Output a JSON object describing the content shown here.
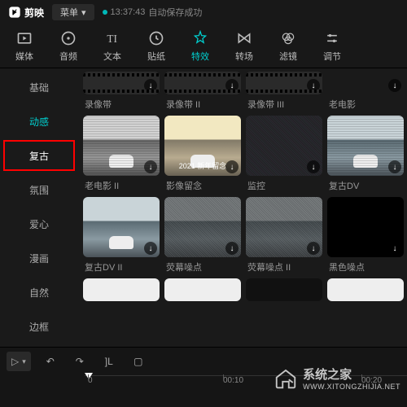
{
  "titlebar": {
    "app_name": "剪映",
    "menu_label": "菜单",
    "save_time": "13:37:43",
    "save_status": "自动保存成功"
  },
  "top_tabs": {
    "media": "媒体",
    "audio": "音频",
    "text": "文本",
    "sticker": "贴纸",
    "effects": "特效",
    "transition": "转场",
    "filter": "滤镜",
    "adjust": "调节"
  },
  "sidebar": {
    "items": [
      "基础",
      "动感",
      "复古",
      "氛围",
      "爱心",
      "漫画",
      "自然",
      "边框"
    ],
    "active": "动感",
    "highlighted": "复古"
  },
  "grid": {
    "row1": [
      "录像带",
      "录像带 II",
      "录像带 III",
      "老电影"
    ],
    "row2": [
      "老电影 II",
      "影像留念",
      "监控",
      "复古DV"
    ],
    "row2_overlay": "2021 新年留念",
    "row3": [
      "复古DV II",
      "荧幕噪点",
      "荧幕噪点 II",
      "黑色噪点"
    ]
  },
  "timeline": {
    "ticks": [
      "0",
      "00:10",
      "00:20"
    ]
  },
  "watermark": {
    "name": "系统之家",
    "url": "WWW.XITONGZHIJIA.NET"
  }
}
